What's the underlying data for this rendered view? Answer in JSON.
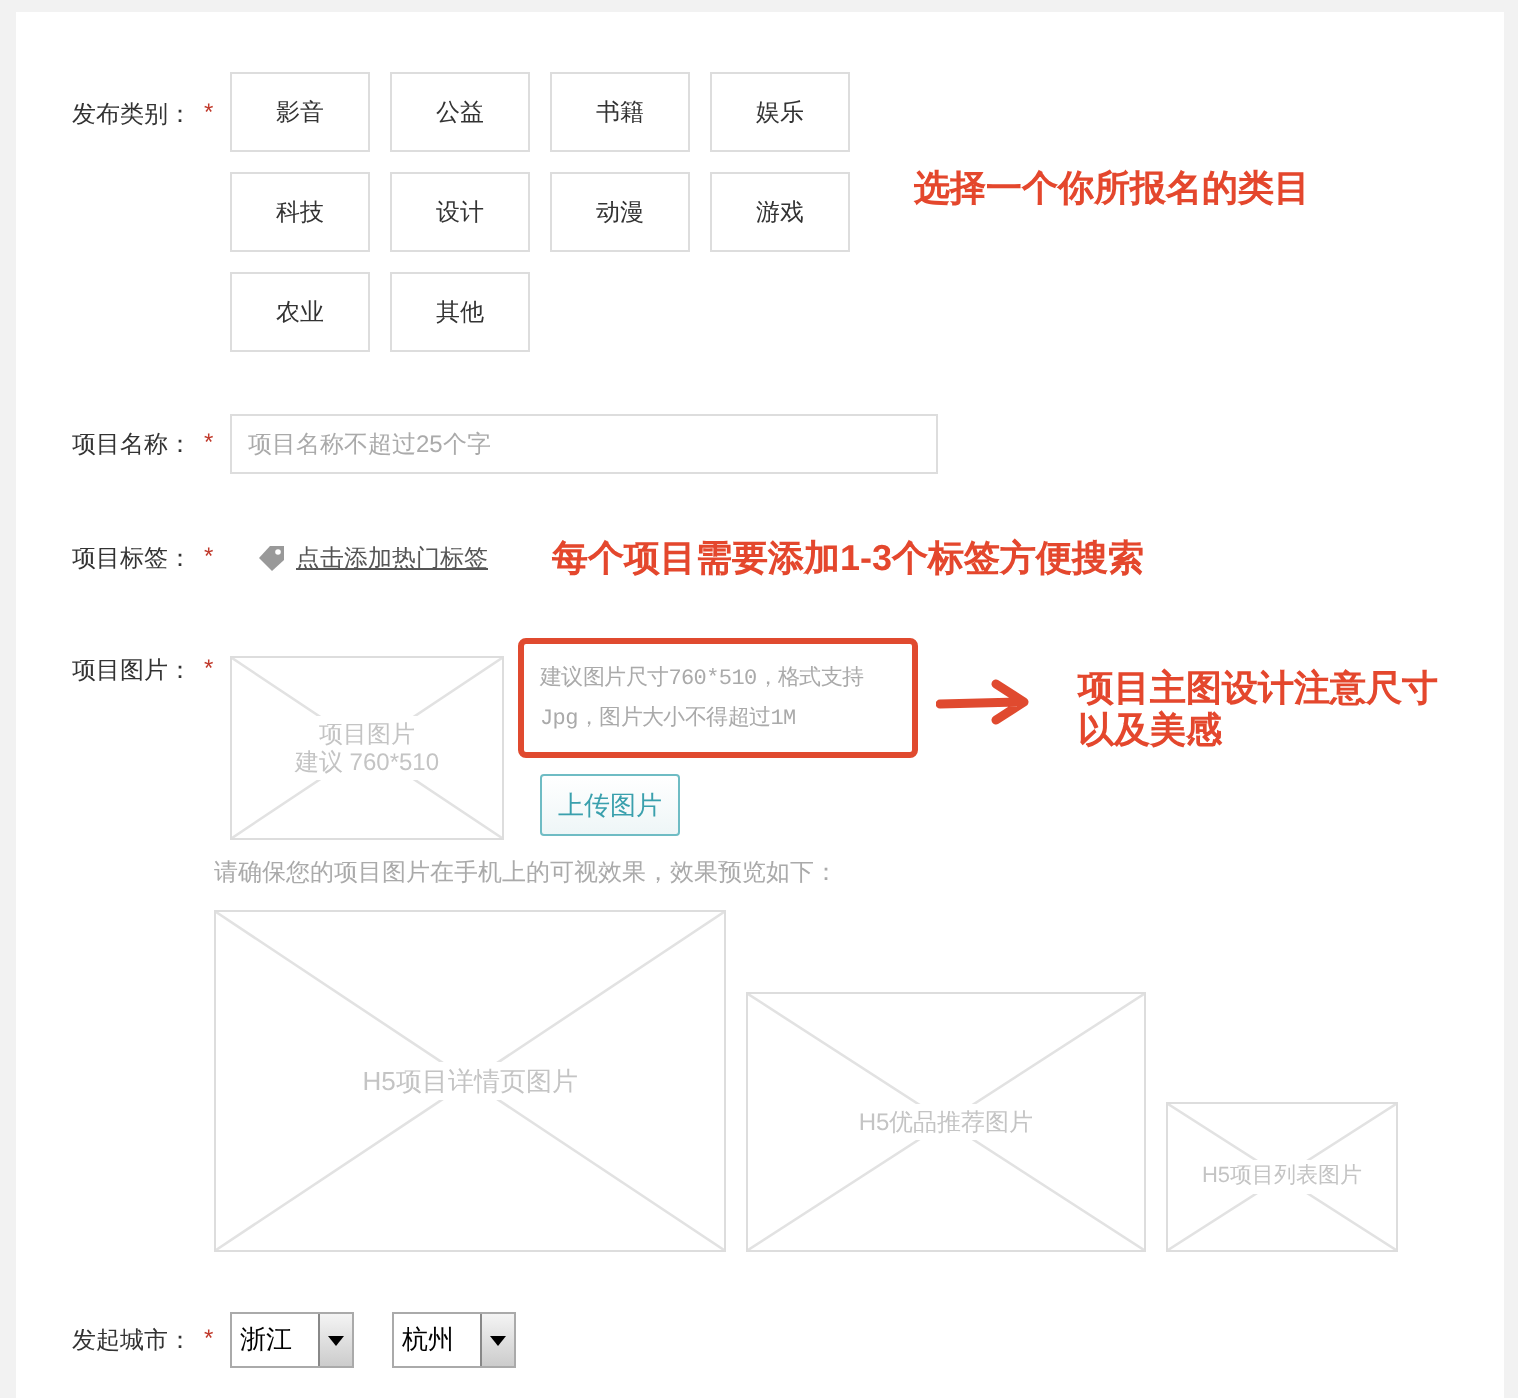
{
  "category": {
    "label": "发布类别：",
    "required_mark": "*",
    "options": [
      "影音",
      "公益",
      "书籍",
      "娱乐",
      "科技",
      "设计",
      "动漫",
      "游戏",
      "农业",
      "其他"
    ],
    "annotation": "选择一个你所报名的类目"
  },
  "name": {
    "label": "项目名称：",
    "required_mark": "*",
    "placeholder": "项目名称不超过25个字"
  },
  "tags": {
    "label": "项目标签：",
    "required_mark": "*",
    "link": "点击添加热门标签",
    "annotation": "每个项目需要添加1-3个标签方便搜索"
  },
  "image": {
    "label": "项目图片：",
    "required_mark": "*",
    "placeholder_lines": [
      "项目图片",
      "建议 760*510"
    ],
    "hint": "建议图片尺寸760*510，格式支持Jpg，图片大小不得超过1M",
    "upload_button": "上传图片",
    "annotation": "项目主图设计注意尺寸以及美感",
    "preview_note": "请确保您的项目图片在手机上的可视效果，效果预览如下：",
    "previews": [
      "H5项目详情页图片",
      "H5优品推荐图片",
      "H5项目列表图片"
    ]
  },
  "city": {
    "label": "发起城市：",
    "required_mark": "*",
    "province": "浙江",
    "city": "杭州"
  }
}
